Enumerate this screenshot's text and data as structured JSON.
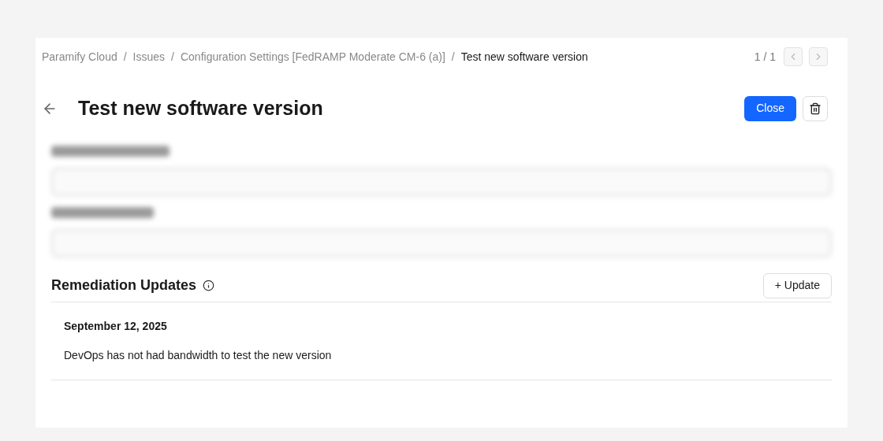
{
  "breadcrumb": [
    {
      "label": "Paramify Cloud",
      "current": false
    },
    {
      "label": "Issues",
      "current": false
    },
    {
      "label": "Configuration Settings [FedRAMP Moderate CM-6 (a)]",
      "current": false
    },
    {
      "label": "Test new software version",
      "current": true
    }
  ],
  "breadcrumb_separator": "/",
  "pager": {
    "text": "1 / 1",
    "prev_disabled": true,
    "next_disabled": true
  },
  "title": "Test new software version",
  "actions": {
    "close": "Close"
  },
  "blurred_fields": [
    {
      "kind": "field"
    },
    {
      "kind": "field"
    }
  ],
  "updates": {
    "title": "Remediation Updates",
    "add_button": "+ Update",
    "entries": [
      {
        "date": "September 12, 2025",
        "text": "DevOps has not had bandwidth to test the new version"
      }
    ]
  }
}
